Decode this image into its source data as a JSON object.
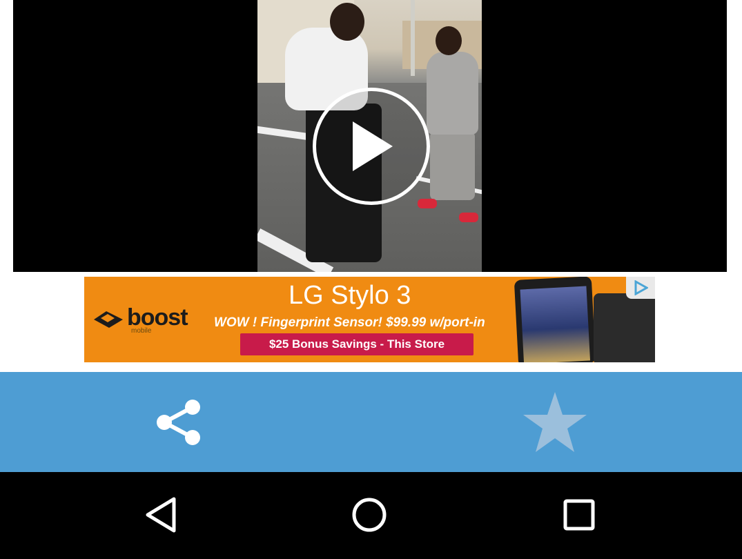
{
  "video": {
    "play_icon": "play-circle-icon"
  },
  "ad": {
    "headline": "LG Stylo 3",
    "brand": "boost",
    "brand_sub": "mobile",
    "offer": "WOW ! Fingerprint Sensor! $99.99 w/port-in",
    "cta": "$25 Bonus Savings - This Store",
    "adchoices_icon": "adchoices-icon",
    "colors": {
      "background": "#f08b12",
      "cta": "#c81b4a"
    }
  },
  "actions": {
    "share_icon": "share-icon",
    "favorite_icon": "star-icon",
    "bar_color": "#4e9dd3"
  },
  "navigation": {
    "back_icon": "back-triangle-icon",
    "home_icon": "home-circle-icon",
    "recents_icon": "recents-square-icon"
  }
}
